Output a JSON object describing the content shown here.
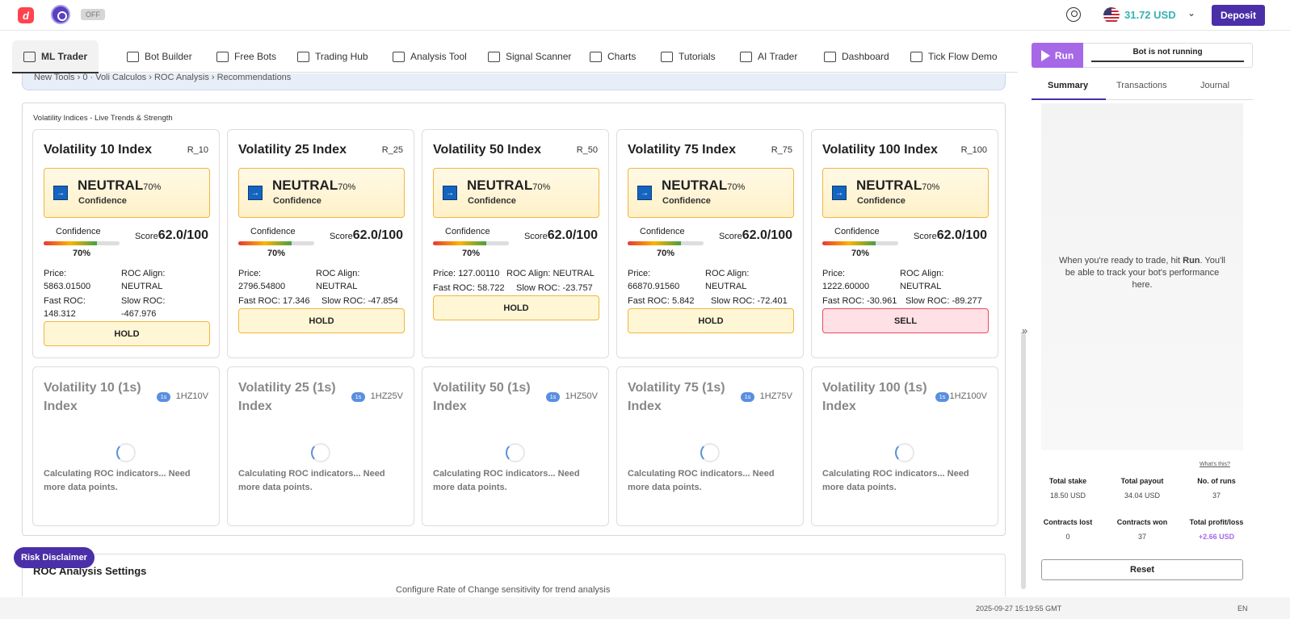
{
  "header": {
    "ext_badge": "OFF",
    "balance": "31.72 USD",
    "deposit_label": "Deposit"
  },
  "nav": {
    "tabs": [
      {
        "label": "ML Trader",
        "icon": "layers-icon"
      },
      {
        "label": "Bot Builder",
        "icon": "bot-icon"
      },
      {
        "label": "Free Bots",
        "icon": "grid-icon"
      },
      {
        "label": "Trading Hub",
        "icon": "swap-icon"
      },
      {
        "label": "Analysis Tool",
        "icon": "sliders-icon"
      },
      {
        "label": "Signal Scanner",
        "icon": "list-icon"
      },
      {
        "label": "Charts",
        "icon": "chart-icon"
      },
      {
        "label": "Tutorials",
        "icon": "play-icon"
      },
      {
        "label": "AI Trader",
        "icon": "layers-icon"
      },
      {
        "label": "Dashboard",
        "icon": "dashboard-icon"
      },
      {
        "label": "Tick Flow Demo",
        "icon": "monitor-icon"
      }
    ]
  },
  "breadcrumb": "New Tools › 0 · Voli Calculos › ROC Analysis › Recommendations",
  "panel": {
    "title": "Volatility Indices - Live Trends & Strength",
    "confidence_label": "Confidence",
    "score_label": "Score",
    "price_label": "Price:",
    "roc_align_label": "ROC Align:",
    "fast_roc_label": "Fast ROC:",
    "slow_roc_label": "Slow ROC:",
    "top_cards": [
      {
        "name": "Volatility 10 Index",
        "symbol": "R_10",
        "signal": "NEUTRAL",
        "pct": "70%",
        "conf": "70%",
        "confidence": 0.7,
        "score": "62.0/100",
        "price": "5863.01500",
        "roc_align": "NEUTRAL",
        "fast_roc": "148.312",
        "slow_roc": "-467.976",
        "action": "HOLD"
      },
      {
        "name": "Volatility 25 Index",
        "symbol": "R_25",
        "signal": "NEUTRAL",
        "pct": "70%",
        "conf": "70%",
        "confidence": 0.7,
        "score": "62.0/100",
        "price": "2796.54800",
        "roc_align": "NEUTRAL",
        "fast_roc": "17.346",
        "slow_roc": "-47.854",
        "action": "HOLD"
      },
      {
        "name": "Volatility 50 Index",
        "symbol": "R_50",
        "signal": "NEUTRAL",
        "pct": "70%",
        "conf": "70%",
        "confidence": 0.7,
        "score": "62.0/100",
        "price": "127.00110",
        "roc_align": "NEUTRAL",
        "fast_roc": "58.722",
        "slow_roc": "-23.757",
        "action": "HOLD"
      },
      {
        "name": "Volatility 75 Index",
        "symbol": "R_75",
        "signal": "NEUTRAL",
        "pct": "70%",
        "conf": "70%",
        "confidence": 0.7,
        "score": "62.0/100",
        "price": "66870.91560",
        "roc_align": "NEUTRAL",
        "fast_roc": "5.842",
        "slow_roc": "-72.401",
        "action": "HOLD"
      },
      {
        "name": "Volatility 100 Index",
        "symbol": "R_100",
        "signal": "NEUTRAL",
        "pct": "70%",
        "conf": "70%",
        "confidence": 0.7,
        "score": "62.0/100",
        "price": "1222.60000",
        "roc_align": "NEUTRAL",
        "fast_roc": "-30.961",
        "slow_roc": "-89.277",
        "action": "SELL"
      }
    ],
    "bottom_cards": [
      {
        "name": "Volatility 10 (1s) Index",
        "badge": "1s",
        "symbol": "1HZ10V",
        "message": "Calculating ROC indicators... Need more data points."
      },
      {
        "name": "Volatility 25 (1s) Index",
        "badge": "1s",
        "symbol": "1HZ25V",
        "message": "Calculating ROC indicators... Need more data points."
      },
      {
        "name": "Volatility 50 (1s) Index",
        "badge": "1s",
        "symbol": "1HZ50V",
        "message": "Calculating ROC indicators... Need more data points."
      },
      {
        "name": "Volatility 75 (1s) Index",
        "badge": "1s",
        "symbol": "1HZ75V",
        "message": "Calculating ROC indicators... Need more data points."
      },
      {
        "name": "Volatility 100 (1s) Index",
        "badge": "1s",
        "symbol": "1HZ100V",
        "message": "Calculating ROC indicators... Need more data points."
      }
    ]
  },
  "settings": {
    "title": "ROC Analysis Settings",
    "subtitle": "Configure Rate of Change sensitivity for trend analysis"
  },
  "risk_disclaimer": "Risk Disclaimer",
  "run_panel": {
    "run_label": "Run",
    "status": "Bot is not running",
    "tabs": [
      "Summary",
      "Transactions",
      "Journal"
    ],
    "empty_message_1": "When you're ready to trade, hit ",
    "empty_message_run": "Run",
    "empty_message_2": ". You'll be able to track your bot's performance here.",
    "whats_this": "What's this?",
    "stats": [
      {
        "label": "Total stake",
        "value": "18.50 USD"
      },
      {
        "label": "Total payout",
        "value": "34.04 USD"
      },
      {
        "label": "No. of runs",
        "value": "37"
      },
      {
        "label": "Contracts lost",
        "value": "0"
      },
      {
        "label": "Contracts won",
        "value": "37"
      },
      {
        "label": "Total profit/loss",
        "value": "+2.66 USD"
      }
    ],
    "reset_label": "Reset"
  },
  "colors": {
    "brand": "#4a2fa8",
    "run": "#a768e8",
    "balance": "#36b3b3",
    "hold_border": "#f0b63d",
    "sell_border": "#e84a5f",
    "profit": "#a768e8"
  },
  "footer": {
    "timestamp": "2025-09-27 15:19:55 GMT",
    "language": "EN"
  }
}
